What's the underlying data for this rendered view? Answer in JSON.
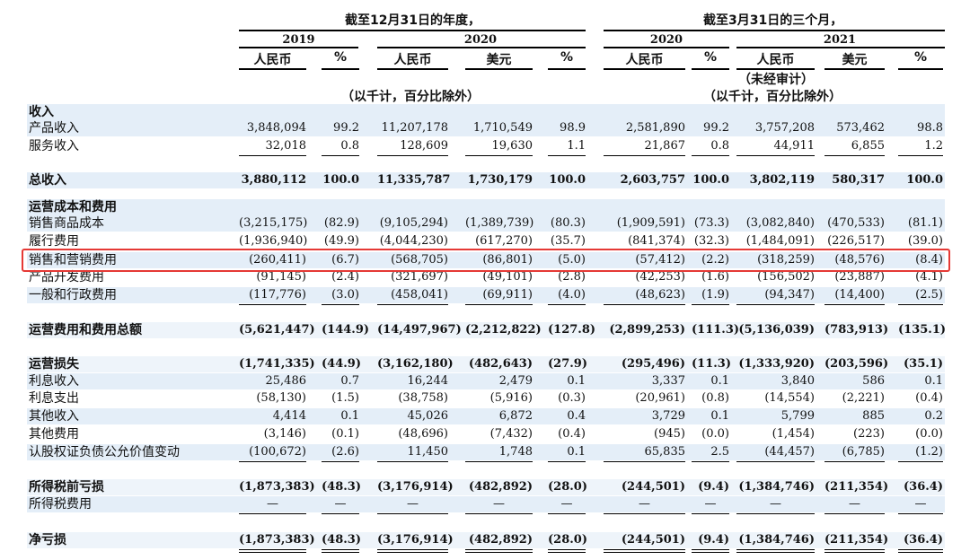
{
  "header": {
    "annual_title": "截至12月31日的年度，",
    "quarter_title": "截至3月31日的三个月，",
    "years": [
      "2019",
      "2020",
      "2020",
      "2021"
    ],
    "currencies": [
      "人民币",
      "%",
      "人民币",
      "美元",
      "%",
      "人民币",
      "%",
      "人民币",
      "美元",
      "%"
    ],
    "unaudited": "（未经审计）",
    "unit_note_annual": "（以千计，百分比除外）",
    "unit_note_quarter": "（以千计，百分比除外）"
  },
  "rows": [
    {
      "label": "收入",
      "type": "section"
    },
    {
      "label": "产品收入",
      "values": [
        "3,848,094",
        "99.2",
        "11,207,178",
        "1,710,549",
        "98.9",
        "2,581,890",
        "99.2",
        "3,757,208",
        "573,462",
        "98.8"
      ]
    },
    {
      "label": "服务收入",
      "values": [
        "32,018",
        "0.8",
        "128,609",
        "19,630",
        "1.1",
        "21,867",
        "0.8",
        "44,911",
        "6,855",
        "1.2"
      ]
    },
    {
      "label": "总收入",
      "bold": true,
      "values": [
        "3,880,112",
        "100.0",
        "11,335,787",
        "1,730,179",
        "100.0",
        "2,603,757",
        "100.0",
        "3,802,119",
        "580,317",
        "100.0"
      ]
    },
    {
      "label": "运营成本和费用",
      "type": "section"
    },
    {
      "label": "销售商品成本",
      "values": [
        "(3,215,175)",
        "(82.9)",
        "(9,105,294)",
        "(1,389,739)",
        "(80.3)",
        "(1,909,591)",
        "(73.3)",
        "(3,082,840)",
        "(470,533)",
        "(81.1)"
      ]
    },
    {
      "label": "履行费用",
      "values": [
        "(1,936,940)",
        "(49.9)",
        "(4,044,230)",
        "(617,270)",
        "(35.7)",
        "(841,374)",
        "(32.3)",
        "(1,484,091)",
        "(226,517)",
        "(39.0)"
      ]
    },
    {
      "label": "销售和营销费用",
      "highlighted": true,
      "values": [
        "(260,411)",
        "(6.7)",
        "(568,705)",
        "(86,801)",
        "(5.0)",
        "(57,412)",
        "(2.2)",
        "(318,259)",
        "(48,576)",
        "(8.4)"
      ]
    },
    {
      "label": "产品开发费用",
      "values": [
        "(91,145)",
        "(2.4)",
        "(321,697)",
        "(49,101)",
        "(2.8)",
        "(42,253)",
        "(1.6)",
        "(156,502)",
        "(23,887)",
        "(4.1)"
      ]
    },
    {
      "label": "一般和行政费用",
      "values": [
        "(117,776)",
        "(3.0)",
        "(458,041)",
        "(69,911)",
        "(4.0)",
        "(48,623)",
        "(1.9)",
        "(94,347)",
        "(14,400)",
        "(2.5)"
      ]
    },
    {
      "label": "运营费用和费用总额",
      "bold": true,
      "values": [
        "(5,621,447)",
        "(144.9)",
        "(14,497,967)",
        "(2,212,822)",
        "(127.8)",
        "(2,899,253)",
        "(111.3)",
        "(5,136,039)",
        "(783,913)",
        "(135.1)"
      ]
    },
    {
      "label": "运营损失",
      "bold": true,
      "values": [
        "(1,741,335)",
        "(44.9)",
        "(3,162,180)",
        "(482,643)",
        "(27.9)",
        "(295,496)",
        "(11.3)",
        "(1,333,920)",
        "(203,596)",
        "(35.1)"
      ]
    },
    {
      "label": "利息收入",
      "values": [
        "25,486",
        "0.7",
        "16,244",
        "2,479",
        "0.1",
        "3,337",
        "0.1",
        "3,840",
        "586",
        "0.1"
      ]
    },
    {
      "label": "利息支出",
      "values": [
        "(58,130)",
        "(1.5)",
        "(38,758)",
        "(5,916)",
        "(0.3)",
        "(20,961)",
        "(0.8)",
        "(14,554)",
        "(2,221)",
        "(0.4)"
      ]
    },
    {
      "label": "其他收入",
      "values": [
        "4,414",
        "0.1",
        "45,026",
        "6,872",
        "0.4",
        "3,729",
        "0.1",
        "5,799",
        "885",
        "0.2"
      ]
    },
    {
      "label": "其他费用",
      "values": [
        "(3,146)",
        "(0.1)",
        "(48,696)",
        "(7,432)",
        "(0.4)",
        "(945)",
        "(0.0)",
        "(1,454)",
        "(223)",
        "(0.0)"
      ]
    },
    {
      "label": "认股权证负债公允价值变动",
      "values": [
        "(100,672)",
        "(2.6)",
        "11,450",
        "1,748",
        "0.1",
        "65,835",
        "2.5",
        "(44,457)",
        "(6,785)",
        "(1.2)"
      ]
    },
    {
      "label": "所得税前亏损",
      "bold": true,
      "values": [
        "(1,873,383)",
        "(48.3)",
        "(3,176,914)",
        "(482,892)",
        "(28.0)",
        "(244,501)",
        "(9.4)",
        "(1,384,746)",
        "(211,354)",
        "(36.4)"
      ]
    },
    {
      "label": "所得税费用",
      "values": [
        "—",
        "—",
        "—",
        "—",
        "—",
        "—",
        "—",
        "—",
        "—",
        "—"
      ]
    },
    {
      "label": "净亏损",
      "bold": true,
      "values": [
        "(1,873,383)",
        "(48.3)",
        "(3,176,914)",
        "(482,892)",
        "(28.0)",
        "(244,501)",
        "(9.4)",
        "(1,384,746)",
        "(211,354)",
        "(36.4)"
      ]
    }
  ]
}
